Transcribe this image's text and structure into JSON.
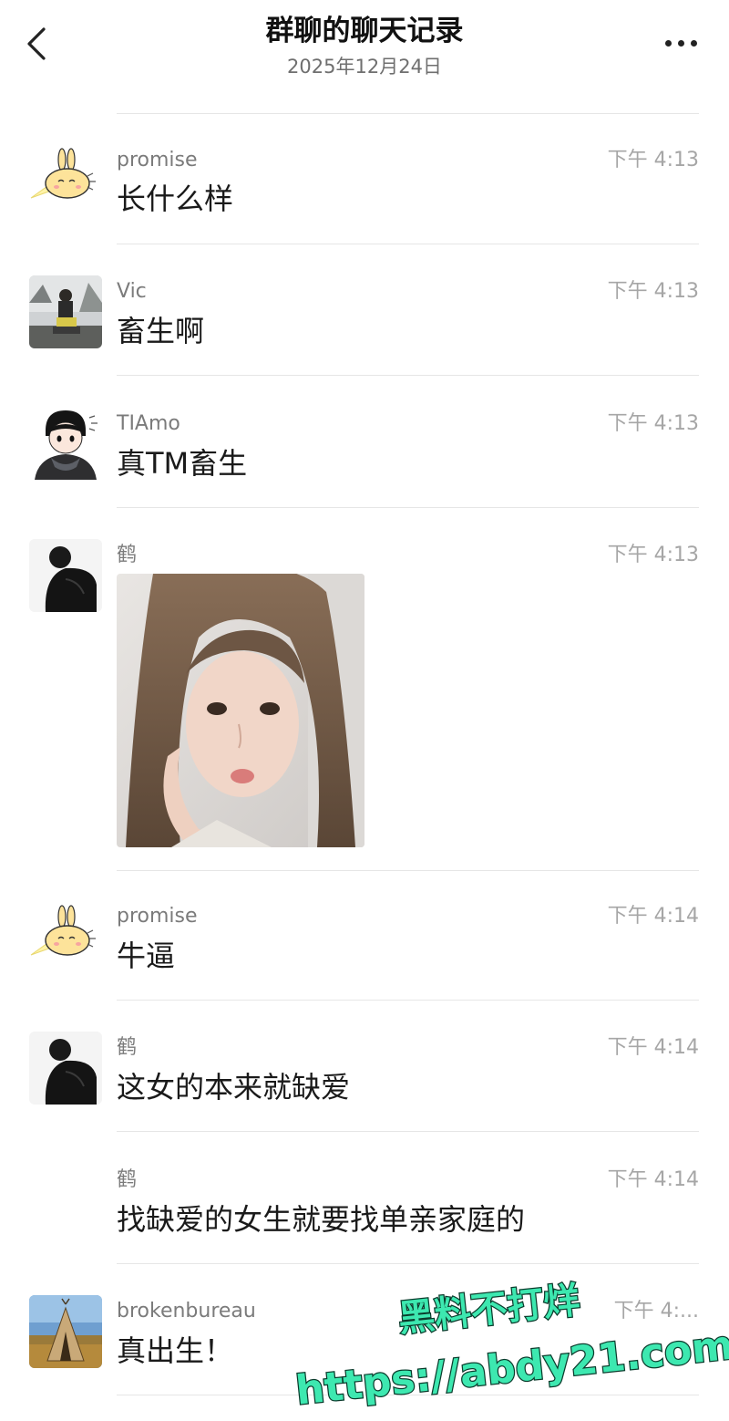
{
  "header": {
    "title": "群聊的聊天记录",
    "date": "2025年12月24日"
  },
  "messages": [
    {
      "sender": "promise",
      "time": "下午 4:13",
      "text": "长什么样",
      "avatar": "bunny-avatar"
    },
    {
      "sender": "Vic",
      "time": "下午 4:13",
      "text": "畜生啊",
      "avatar": "photo-avatar"
    },
    {
      "sender": "TIAmo",
      "time": "下午 4:13",
      "text": "真TM畜生",
      "avatar": "cartoon-boy-avatar"
    },
    {
      "sender": "鹤",
      "time": "下午 4:13",
      "text": "",
      "avatar": "dark-figure-avatar",
      "image": "selfie-photo"
    },
    {
      "sender": "promise",
      "time": "下午 4:14",
      "text": "牛逼",
      "avatar": "bunny-avatar"
    },
    {
      "sender": "鹤",
      "time": "下午 4:14",
      "text": "这女的本来就缺爱",
      "avatar": "dark-figure-avatar"
    },
    {
      "sender": "鹤",
      "time": "下午 4:14",
      "text": "找缺爱的女生就要找单亲家庭的",
      "avatar": ""
    },
    {
      "sender": "brokenbureau",
      "time": "下午 4:...",
      "text": "真出生！",
      "avatar": "tent-avatar"
    }
  ],
  "watermark": {
    "line1": "黑料不打烊",
    "line2": "https://abdy21.com"
  },
  "colors": {
    "background": "#ffffff",
    "watermark_fill": "#3de8b0",
    "watermark_stroke": "#0b3b2c",
    "time_gray": "#a6a6a6"
  }
}
